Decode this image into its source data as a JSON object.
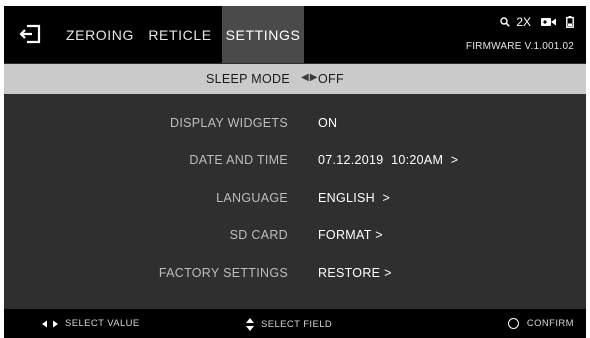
{
  "header": {
    "tabs": [
      {
        "label": "ZEROING"
      },
      {
        "label": "RETICLE"
      },
      {
        "label": "SETTINGS",
        "active": true
      }
    ],
    "zoom": "2X",
    "firmware": "FIRMWARE V.1.001.02"
  },
  "settings": {
    "rows": [
      {
        "label": "SLEEP MODE",
        "value": "OFF",
        "selected": true
      },
      {
        "label": "DISPLAY WIDGETS",
        "value": "ON"
      },
      {
        "label": "DATE AND TIME",
        "value": "07.12.2019  10:20AM  >"
      },
      {
        "label": "LANGUAGE",
        "value": "ENGLISH  >"
      },
      {
        "label": "SD CARD",
        "value": "FORMAT >"
      },
      {
        "label": "FACTORY SETTINGS",
        "value": "RESTORE >"
      }
    ]
  },
  "footer": {
    "select_value": "SELECT VALUE",
    "select_field": "SELECT FIELD",
    "confirm": "CONFIRM"
  },
  "colors": {
    "background": "#2f2f2f",
    "bars": "#000000",
    "active_tab": "#4a4a4a",
    "selected_row": "#cacaca"
  },
  "icons": [
    "exit-icon",
    "zoom-icon",
    "video-camera-icon",
    "battery-icon",
    "left-right-arrows-icon",
    "up-down-arrows-icon",
    "circle-button-icon"
  ]
}
